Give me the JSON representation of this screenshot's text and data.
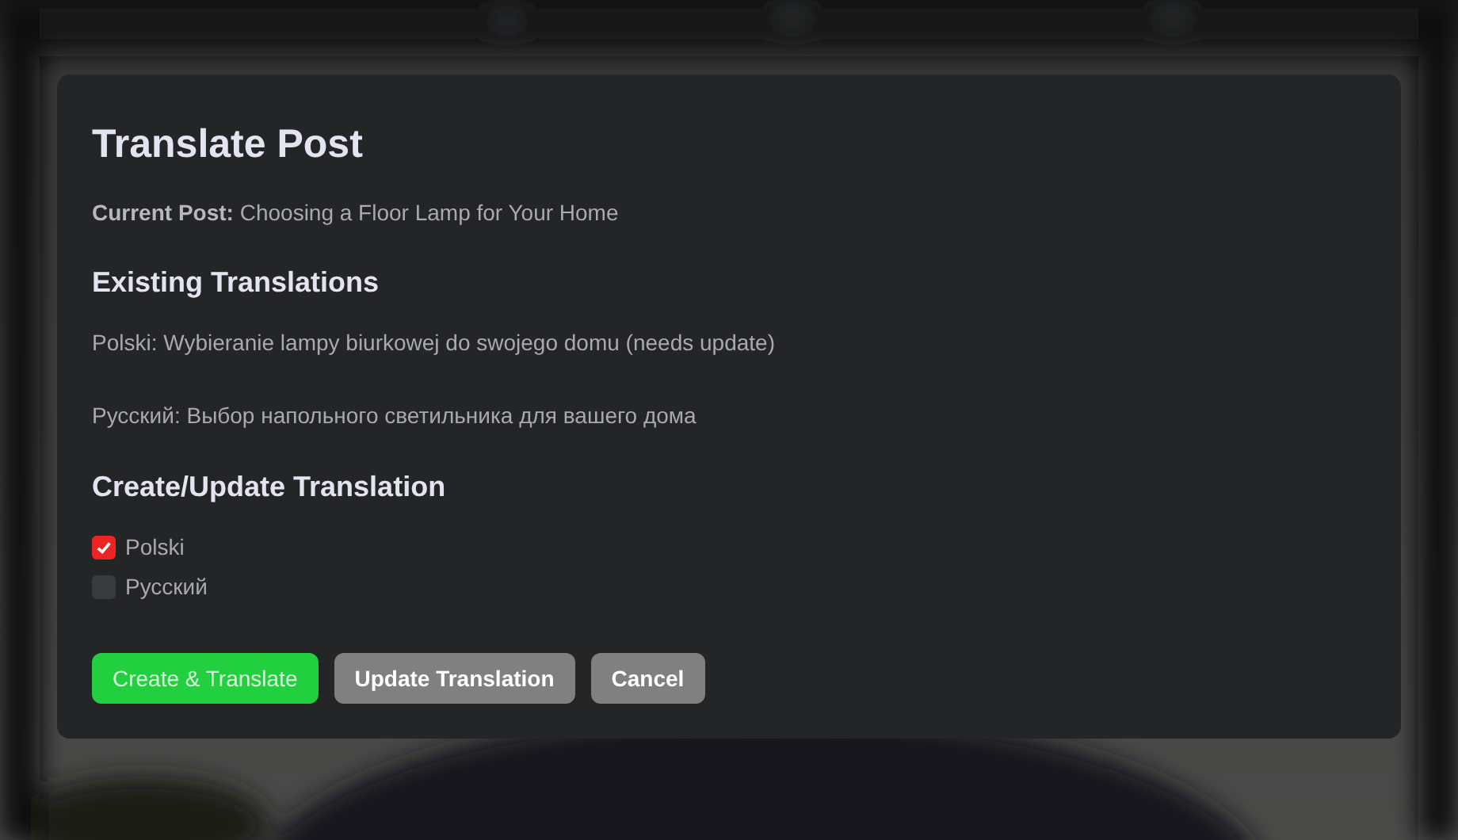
{
  "dialog": {
    "title": "Translate Post",
    "current_post": {
      "label": "Current Post:",
      "value": "Choosing a Floor Lamp for Your Home"
    },
    "existing_heading": "Existing Translations",
    "existing": [
      "Polski: Wybieranie lampy biurkowej do swojego domu (needs update)",
      "Русский: Выбор напольного светильника для вашего дома"
    ],
    "create_heading": "Create/Update Translation",
    "languages": [
      {
        "label": "Polski",
        "checked": true
      },
      {
        "label": "Русский",
        "checked": false
      }
    ],
    "buttons": [
      {
        "label": "Create & Translate",
        "kind": "primary"
      },
      {
        "label": "Update Translation",
        "kind": "secondary"
      },
      {
        "label": "Cancel",
        "kind": "secondary"
      }
    ]
  }
}
